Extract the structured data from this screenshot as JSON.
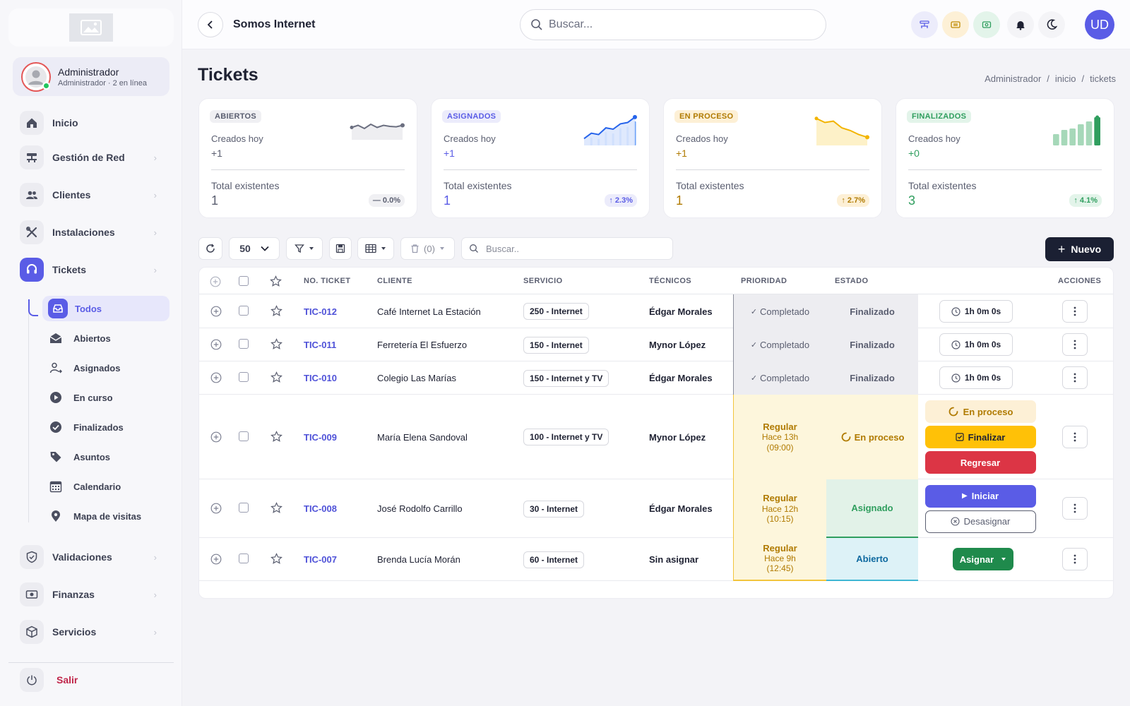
{
  "sidebar": {
    "user_name": "Administrador",
    "user_sub": "Administrador · 2 en línea",
    "nav": [
      {
        "label": "Inicio",
        "icon": "home-icon"
      },
      {
        "label": "Gestión de Red",
        "icon": "network-icon"
      },
      {
        "label": "Clientes",
        "icon": "users-icon"
      },
      {
        "label": "Instalaciones",
        "icon": "tools-icon"
      },
      {
        "label": "Tickets",
        "icon": "headset-icon"
      }
    ],
    "sub": [
      {
        "label": "Todos",
        "icon": "inbox-icon"
      },
      {
        "label": "Abiertos",
        "icon": "envelope-open-icon"
      },
      {
        "label": "Asignados",
        "icon": "user-assign-icon"
      },
      {
        "label": "En curso",
        "icon": "play-circle-icon"
      },
      {
        "label": "Finalizados",
        "icon": "check-circle-icon"
      },
      {
        "label": "Asuntos",
        "icon": "tag-icon"
      },
      {
        "label": "Calendario",
        "icon": "calendar-icon"
      },
      {
        "label": "Mapa de visitas",
        "icon": "map-pin-icon"
      }
    ],
    "nav2": [
      {
        "label": "Validaciones",
        "icon": "shield-check-icon"
      },
      {
        "label": "Finanzas",
        "icon": "money-icon"
      },
      {
        "label": "Servicios",
        "icon": "box-icon"
      }
    ],
    "logout": "Salir"
  },
  "topbar": {
    "company": "Somos Internet",
    "search_placeholder": "Buscar...",
    "avatar_initials": "UD"
  },
  "page": {
    "title": "Tickets",
    "breadcrumb": [
      "Administrador",
      "/",
      "inicio",
      "/",
      "tickets"
    ]
  },
  "cards": [
    {
      "badge": "ABIERTOS",
      "today_label": "Creados hoy",
      "today_value": "+1",
      "total_label": "Total existentes",
      "total_value": "1",
      "pct": "— 0.0%",
      "accent": "#5a5e70",
      "trend": [
        0.45,
        0.55,
        0.4,
        0.6,
        0.45,
        0.55,
        0.5,
        0.48,
        0.55
      ]
    },
    {
      "badge": "ASIGNADOS",
      "today_label": "Creados hoy",
      "today_value": "+1",
      "total_label": "Total existentes",
      "total_value": "1",
      "pct": "↑ 2.3%",
      "accent": "#5a5ce6",
      "trend": [
        0.15,
        0.35,
        0.3,
        0.55,
        0.5,
        0.7,
        0.75,
        0.95
      ]
    },
    {
      "badge": "EN PROCESO",
      "today_label": "Creados hoy",
      "today_value": "+1",
      "total_label": "Total existentes",
      "total_value": "1",
      "pct": "↑ 2.7%",
      "accent": "#e0a800",
      "trend": [
        0.9,
        0.75,
        0.8,
        0.55,
        0.45,
        0.3,
        0.2
      ]
    },
    {
      "badge": "FINALIZADOS",
      "today_label": "Creados hoy",
      "today_value": "+0",
      "total_label": "Total existentes",
      "total_value": "3",
      "pct": "↑ 4.1%",
      "accent": "#2f9e5e",
      "trend": [
        0.4,
        0.55,
        0.6,
        0.75,
        0.85,
        1.0
      ]
    }
  ],
  "toolbar": {
    "page_size": "50",
    "trash_count": "(0)",
    "search_placeholder": "Buscar..",
    "new_label": "Nuevo"
  },
  "table": {
    "columns": [
      "NO. TICKET",
      "CLIENTE",
      "SERVICIO",
      "TÉCNICOS",
      "PRIORIDAD",
      "ESTADO",
      "ACCIONES"
    ],
    "rows": [
      {
        "id": "TIC-012",
        "client": "Café Internet La Estación",
        "service": "250 - Internet",
        "tech": "Édgar Morales",
        "priority": "Completado",
        "status": "Finalizado",
        "timer": "1h 0m 0s"
      },
      {
        "id": "TIC-011",
        "client": "Ferretería El Esfuerzo",
        "service": "150 - Internet",
        "tech": "Mynor López",
        "priority": "Completado",
        "status": "Finalizado",
        "timer": "1h 0m 0s"
      },
      {
        "id": "TIC-010",
        "client": "Colegio Las Marías",
        "service": "150 - Internet y TV",
        "tech": "Édgar Morales",
        "priority": "Completado",
        "status": "Finalizado",
        "timer": "1h 0m 0s"
      },
      {
        "id": "TIC-009",
        "client": "María Elena Sandoval",
        "service": "100 - Internet y TV",
        "tech": "Mynor López",
        "priority": "Regular",
        "priority_ago": "Hace 13h",
        "priority_time": "(09:00)",
        "status": "En proceso",
        "actions": [
          "En proceso",
          "Finalizar",
          "Regresar"
        ]
      },
      {
        "id": "TIC-008",
        "client": "José Rodolfo Carrillo",
        "service": "30 - Internet",
        "tech": "Édgar Morales",
        "priority": "Regular",
        "priority_ago": "Hace 12h",
        "priority_time": "(10:15)",
        "status": "Asignado",
        "actions": [
          "Iniciar",
          "Desasignar"
        ]
      },
      {
        "id": "TIC-007",
        "client": "Brenda Lucía Morán",
        "service": "60 - Internet",
        "tech": "Sin asignar",
        "priority": "Regular",
        "priority_ago": "Hace 9h",
        "priority_time": "(12:45)",
        "status": "Abierto",
        "actions": [
          "Asignar"
        ]
      }
    ]
  }
}
